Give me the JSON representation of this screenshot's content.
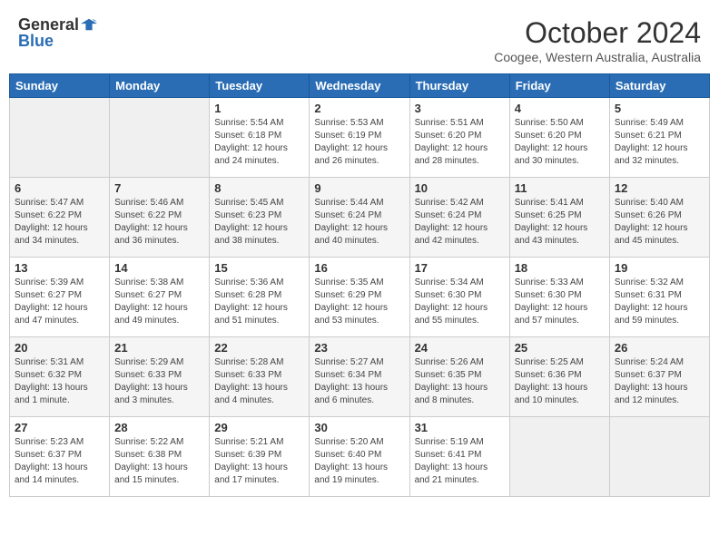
{
  "header": {
    "logo_general": "General",
    "logo_blue": "Blue",
    "month_title": "October 2024",
    "subtitle": "Coogee, Western Australia, Australia"
  },
  "days_of_week": [
    "Sunday",
    "Monday",
    "Tuesday",
    "Wednesday",
    "Thursday",
    "Friday",
    "Saturday"
  ],
  "weeks": [
    [
      {
        "day": "",
        "info": ""
      },
      {
        "day": "",
        "info": ""
      },
      {
        "day": "1",
        "info": "Sunrise: 5:54 AM\nSunset: 6:18 PM\nDaylight: 12 hours and 24 minutes."
      },
      {
        "day": "2",
        "info": "Sunrise: 5:53 AM\nSunset: 6:19 PM\nDaylight: 12 hours and 26 minutes."
      },
      {
        "day": "3",
        "info": "Sunrise: 5:51 AM\nSunset: 6:20 PM\nDaylight: 12 hours and 28 minutes."
      },
      {
        "day": "4",
        "info": "Sunrise: 5:50 AM\nSunset: 6:20 PM\nDaylight: 12 hours and 30 minutes."
      },
      {
        "day": "5",
        "info": "Sunrise: 5:49 AM\nSunset: 6:21 PM\nDaylight: 12 hours and 32 minutes."
      }
    ],
    [
      {
        "day": "6",
        "info": "Sunrise: 5:47 AM\nSunset: 6:22 PM\nDaylight: 12 hours and 34 minutes."
      },
      {
        "day": "7",
        "info": "Sunrise: 5:46 AM\nSunset: 6:22 PM\nDaylight: 12 hours and 36 minutes."
      },
      {
        "day": "8",
        "info": "Sunrise: 5:45 AM\nSunset: 6:23 PM\nDaylight: 12 hours and 38 minutes."
      },
      {
        "day": "9",
        "info": "Sunrise: 5:44 AM\nSunset: 6:24 PM\nDaylight: 12 hours and 40 minutes."
      },
      {
        "day": "10",
        "info": "Sunrise: 5:42 AM\nSunset: 6:24 PM\nDaylight: 12 hours and 42 minutes."
      },
      {
        "day": "11",
        "info": "Sunrise: 5:41 AM\nSunset: 6:25 PM\nDaylight: 12 hours and 43 minutes."
      },
      {
        "day": "12",
        "info": "Sunrise: 5:40 AM\nSunset: 6:26 PM\nDaylight: 12 hours and 45 minutes."
      }
    ],
    [
      {
        "day": "13",
        "info": "Sunrise: 5:39 AM\nSunset: 6:27 PM\nDaylight: 12 hours and 47 minutes."
      },
      {
        "day": "14",
        "info": "Sunrise: 5:38 AM\nSunset: 6:27 PM\nDaylight: 12 hours and 49 minutes."
      },
      {
        "day": "15",
        "info": "Sunrise: 5:36 AM\nSunset: 6:28 PM\nDaylight: 12 hours and 51 minutes."
      },
      {
        "day": "16",
        "info": "Sunrise: 5:35 AM\nSunset: 6:29 PM\nDaylight: 12 hours and 53 minutes."
      },
      {
        "day": "17",
        "info": "Sunrise: 5:34 AM\nSunset: 6:30 PM\nDaylight: 12 hours and 55 minutes."
      },
      {
        "day": "18",
        "info": "Sunrise: 5:33 AM\nSunset: 6:30 PM\nDaylight: 12 hours and 57 minutes."
      },
      {
        "day": "19",
        "info": "Sunrise: 5:32 AM\nSunset: 6:31 PM\nDaylight: 12 hours and 59 minutes."
      }
    ],
    [
      {
        "day": "20",
        "info": "Sunrise: 5:31 AM\nSunset: 6:32 PM\nDaylight: 13 hours and 1 minute."
      },
      {
        "day": "21",
        "info": "Sunrise: 5:29 AM\nSunset: 6:33 PM\nDaylight: 13 hours and 3 minutes."
      },
      {
        "day": "22",
        "info": "Sunrise: 5:28 AM\nSunset: 6:33 PM\nDaylight: 13 hours and 4 minutes."
      },
      {
        "day": "23",
        "info": "Sunrise: 5:27 AM\nSunset: 6:34 PM\nDaylight: 13 hours and 6 minutes."
      },
      {
        "day": "24",
        "info": "Sunrise: 5:26 AM\nSunset: 6:35 PM\nDaylight: 13 hours and 8 minutes."
      },
      {
        "day": "25",
        "info": "Sunrise: 5:25 AM\nSunset: 6:36 PM\nDaylight: 13 hours and 10 minutes."
      },
      {
        "day": "26",
        "info": "Sunrise: 5:24 AM\nSunset: 6:37 PM\nDaylight: 13 hours and 12 minutes."
      }
    ],
    [
      {
        "day": "27",
        "info": "Sunrise: 5:23 AM\nSunset: 6:37 PM\nDaylight: 13 hours and 14 minutes."
      },
      {
        "day": "28",
        "info": "Sunrise: 5:22 AM\nSunset: 6:38 PM\nDaylight: 13 hours and 15 minutes."
      },
      {
        "day": "29",
        "info": "Sunrise: 5:21 AM\nSunset: 6:39 PM\nDaylight: 13 hours and 17 minutes."
      },
      {
        "day": "30",
        "info": "Sunrise: 5:20 AM\nSunset: 6:40 PM\nDaylight: 13 hours and 19 minutes."
      },
      {
        "day": "31",
        "info": "Sunrise: 5:19 AM\nSunset: 6:41 PM\nDaylight: 13 hours and 21 minutes."
      },
      {
        "day": "",
        "info": ""
      },
      {
        "day": "",
        "info": ""
      }
    ]
  ]
}
